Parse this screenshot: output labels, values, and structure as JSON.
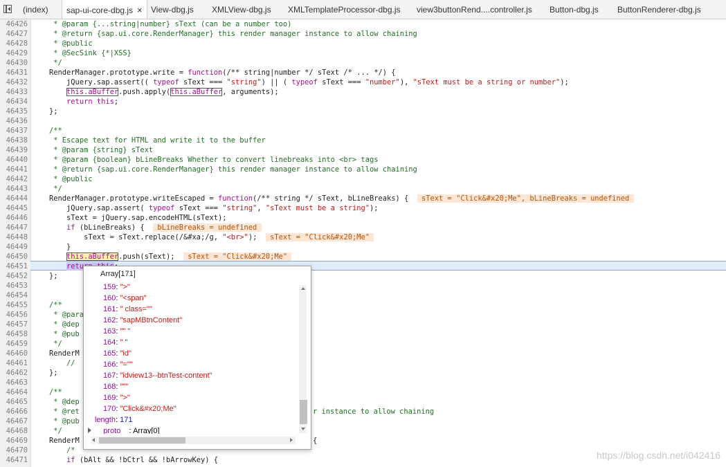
{
  "tabs": [
    {
      "label": "(index)",
      "active": false
    },
    {
      "label": "sap-ui-core-dbg.js",
      "active": true
    },
    {
      "label": "View-dbg.js",
      "active": false
    },
    {
      "label": "XMLView-dbg.js",
      "active": false
    },
    {
      "label": "XMLTemplateProcessor-dbg.js",
      "active": false
    },
    {
      "label": "view3buttonRend....controller.js",
      "active": false
    },
    {
      "label": "Button-dbg.js",
      "active": false
    },
    {
      "label": "ButtonRenderer-dbg.js",
      "active": false
    }
  ],
  "tab_close_glyph": "×",
  "line_numbers": [
    "46426",
    "46427",
    "46428",
    "46429",
    "46430",
    "46431",
    "46432",
    "46433",
    "46434",
    "46435",
    "46436",
    "46437",
    "46438",
    "46439",
    "46440",
    "46441",
    "46442",
    "46443",
    "46444",
    "46445",
    "46446",
    "46447",
    "46448",
    "46449",
    "46450",
    "46451",
    "46452",
    "46453",
    "46454",
    "46455",
    "46456",
    "46457",
    "46458",
    "46459",
    "46460",
    "46461",
    "46462",
    "46463",
    "46464",
    "46465",
    "46466",
    "46467",
    "46468",
    "46469",
    "46470",
    "46471"
  ],
  "code": {
    "l0": "     * @param {...string|number} sText (can be a number too)",
    "l1": "     * @return {sap.ui.core.RenderManager} this render manager instance to allow chaining",
    "l2": "     * @public",
    "l3": "     * @SecSink {*|XSS}",
    "l4": "     */",
    "l5a": "    RenderManager.prototype.write = ",
    "l5b": "function",
    "l5c": "(/** string|number */ sText /* ... */) {",
    "l6a": "        jQuery.sap.assert(( ",
    "l6b": "typeof",
    "l6c": " sText === ",
    "l6d": "\"string\"",
    "l6e": ") || ( ",
    "l6f": "typeof",
    "l6g": " sText === ",
    "l6h": "\"number\"",
    "l6i": "), ",
    "l6j": "\"sText must be a string or number\"",
    "l6k": ");",
    "l7a": "        ",
    "l7b": "this.aBuffer",
    "l7c": ".push.apply(",
    "l7d": "this.aBuffer",
    "l7e": ", arguments);",
    "l8a": "        ",
    "l8b": "return this",
    "l8c": ";",
    "l9": "    };",
    "l10": "",
    "l11": "    /**",
    "l12": "     * Escape text for HTML and write it to the buffer",
    "l13": "     * @param {string} sText",
    "l14": "     * @param {boolean} bLineBreaks Whether to convert linebreaks into <br> tags",
    "l15": "     * @return {sap.ui.core.RenderManager} this render manager instance to allow chaining",
    "l16": "     * @public",
    "l17": "     */",
    "l18a": "    RenderManager.prototype.writeEscaped = ",
    "l18b": "function",
    "l18c": "(/** string */ sText, bLineBreaks) {  ",
    "l18d": " sText = \"Click&#x20;Me\", bLineBreaks = undefined ",
    "l19a": "        jQuery.sap.assert( ",
    "l19b": "typeof",
    "l19c": " sText === ",
    "l19d": "\"string\"",
    "l19e": ", ",
    "l19f": "\"sText must be a string\"",
    "l19g": ");",
    "l20": "        sText = jQuery.sap.encodeHTML(sText);",
    "l21a": "        ",
    "l21b": "if",
    "l21c": " (bLineBreaks) {  ",
    "l21d": " bLineBreaks = undefined ",
    "l22a": "            sText = sText.replace(/&#xa;/g, ",
    "l22b": "\"<br>\"",
    "l22c": ");  ",
    "l22d": " sText = \"Click&#x20;Me\" ",
    "l23": "        }",
    "l24a": "        ",
    "l24b": "this.aBuffer",
    "l24c": ".push(sText);  ",
    "l24d": " sText = \"Click&#x20;Me\" ",
    "l25a": "        ",
    "l25b": "return this",
    "l25c": ";",
    "l26": "    };",
    "l27": "",
    "l28": "",
    "l29": "    /**",
    "l30": "     * @param",
    "l31": "     * @dep",
    "l32": "     * @pub",
    "l33": "     */",
    "l34": "    RenderM",
    "l35": "        //",
    "l36": "    };",
    "l37": "",
    "l38": "    /**",
    "l39": "     * @dep",
    "l40a": "     * @ret",
    "l40b": "r instance to allow chaining",
    "l41": "     * @pub",
    "l42": "     */",
    "l43a": "    RenderM",
    "l43b": "{",
    "l44": "        /*",
    "l45a": "        ",
    "l45b": "if",
    "l45c": " (bAlt && !bCtrl && !bArrowKey) {"
  },
  "popover": {
    "title": "Array[171]",
    "entries": [
      {
        "key": "159",
        "value": "\">\""
      },
      {
        "key": "160",
        "value": "\"<span\""
      },
      {
        "key": "161",
        "value": "\" class=\"\""
      },
      {
        "key": "162",
        "value": "\"sapMBtnContent\""
      },
      {
        "key": "163",
        "value": "\"\" \""
      },
      {
        "key": "164",
        "value": "\" \""
      },
      {
        "key": "165",
        "value": "\"id\""
      },
      {
        "key": "166",
        "value": "\"=\"\""
      },
      {
        "key": "167",
        "value": "\"idview13--btnTest-content\""
      },
      {
        "key": "168",
        "value": "\"\"\""
      },
      {
        "key": "169",
        "value": "\">\""
      },
      {
        "key": "170",
        "value": "\"Click&#x20;Me\""
      }
    ],
    "length_key": "length",
    "length_value": "171",
    "proto_key": "__proto__",
    "proto_value": "Array[0]"
  },
  "watermark": "https://blog.csdn.net/i042416"
}
